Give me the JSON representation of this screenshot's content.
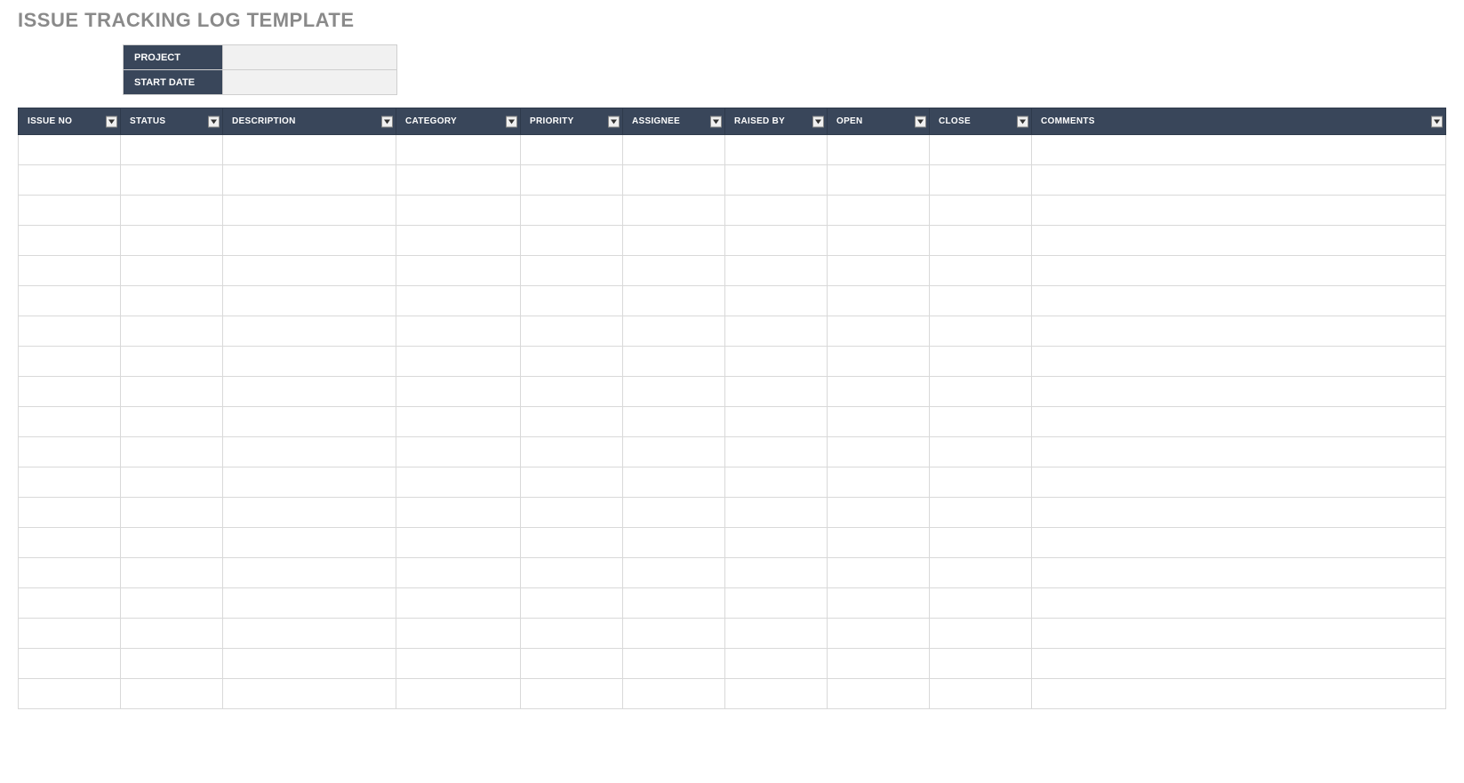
{
  "title": "ISSUE TRACKING LOG TEMPLATE",
  "meta": {
    "project_label": "PROJECT",
    "project_value": "",
    "startdate_label": "START DATE",
    "startdate_value": ""
  },
  "columns": [
    {
      "key": "issue_no",
      "label": "ISSUE NO"
    },
    {
      "key": "status",
      "label": "STATUS"
    },
    {
      "key": "description",
      "label": "DESCRIPTION"
    },
    {
      "key": "category",
      "label": "CATEGORY"
    },
    {
      "key": "priority",
      "label": "PRIORITY"
    },
    {
      "key": "assignee",
      "label": "ASSIGNEE"
    },
    {
      "key": "raised_by",
      "label": "RAISED BY"
    },
    {
      "key": "open",
      "label": "OPEN"
    },
    {
      "key": "close",
      "label": "CLOSE"
    },
    {
      "key": "comments",
      "label": "COMMENTS"
    }
  ],
  "row_count": 19
}
